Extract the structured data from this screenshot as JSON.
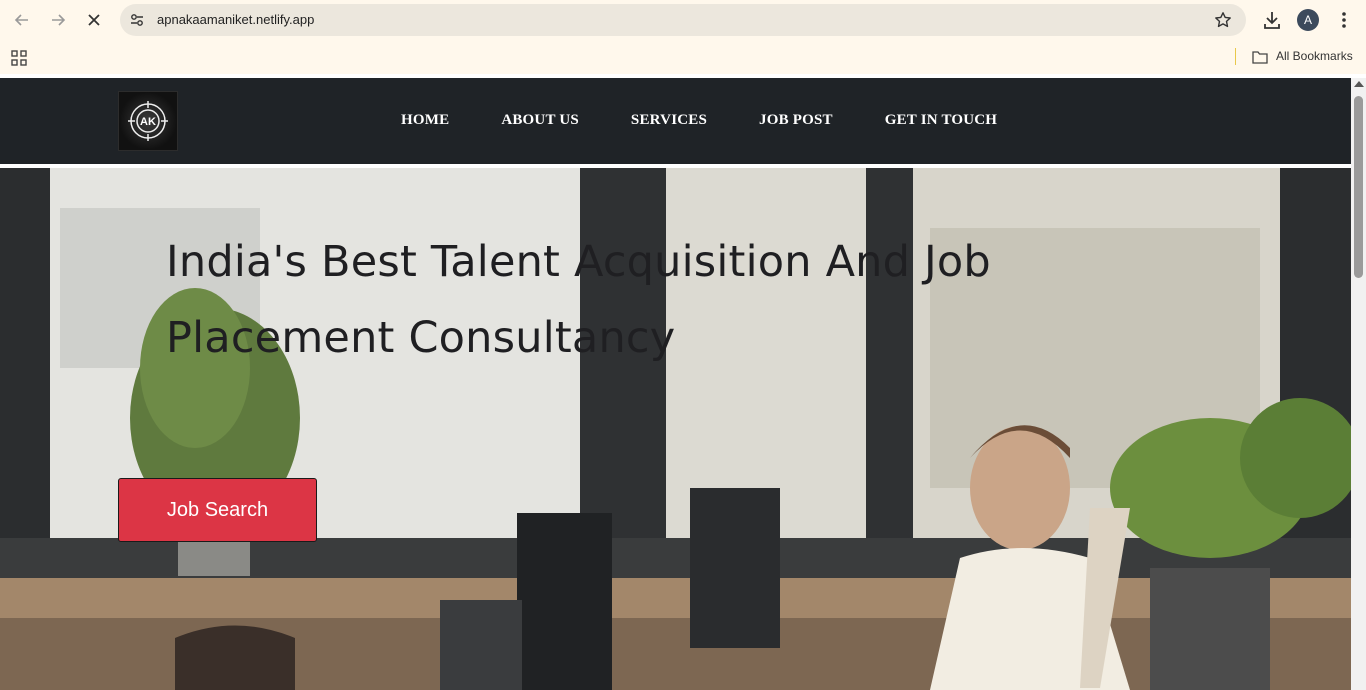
{
  "browser": {
    "url": "apnakaamaniket.netlify.app",
    "profile_initial": "A",
    "bookmarks_label": "All Bookmarks"
  },
  "site": {
    "logo_text": "AK",
    "nav": [
      "HOME",
      "ABOUT US",
      "SERVICES",
      "JOB POST",
      "GET IN TOUCH"
    ]
  },
  "hero": {
    "title": "India's Best Talent Acquisition And Job Placement Consultancy",
    "button_label": "Job Search"
  },
  "colors": {
    "nav_bg": "#1f2327",
    "button_bg": "#dc3545",
    "browser_chrome": "#fff8ec"
  },
  "icons": [
    "back-icon",
    "forward-icon",
    "stop-icon",
    "site-settings-icon",
    "bookmark-star-icon",
    "download-icon",
    "menu-icon",
    "apps-icon",
    "folder-icon"
  ]
}
